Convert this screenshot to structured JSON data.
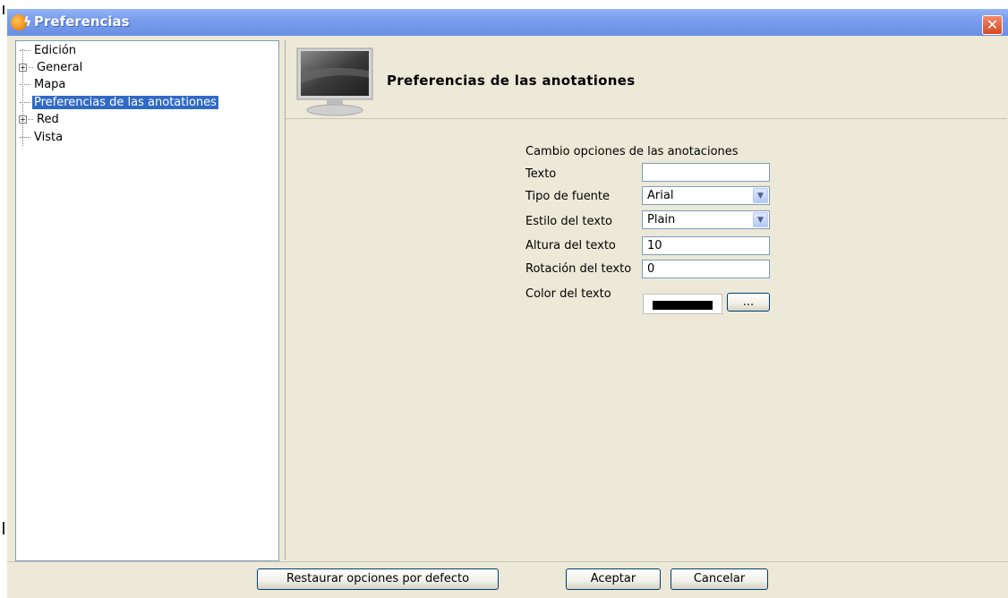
{
  "window": {
    "title": "Preferencias",
    "close_glyph": "✕"
  },
  "tree": {
    "items": [
      {
        "label": "Edición",
        "expandable": false,
        "selected": false
      },
      {
        "label": "General",
        "expandable": true,
        "selected": false
      },
      {
        "label": "Mapa",
        "expandable": false,
        "selected": false
      },
      {
        "label": "Preferencias de las anotationes",
        "expandable": false,
        "selected": true
      },
      {
        "label": "Red",
        "expandable": true,
        "selected": false
      },
      {
        "label": "Vista",
        "expandable": false,
        "selected": false
      }
    ]
  },
  "header": {
    "title": "Preferencias de las anotationes",
    "icon": "monitor-icon"
  },
  "form": {
    "section_title": "Cambio opciones de las anotaciones",
    "texto": {
      "label": "Texto",
      "value": ""
    },
    "tipo_fuente": {
      "label": "Tipo de fuente",
      "value": "Arial"
    },
    "estilo_texto": {
      "label": "Estilo del texto",
      "value": "Plain"
    },
    "altura_texto": {
      "label": "Altura del texto",
      "value": "10"
    },
    "rotacion_texto": {
      "label": "Rotación del texto",
      "value": "0"
    },
    "color_texto": {
      "label": "Color del texto",
      "value": "#000000",
      "button_label": "..."
    }
  },
  "buttons": {
    "restore": "Restaurar opciones por defecto",
    "accept": "Aceptar",
    "cancel": "Cancelar"
  },
  "colors": {
    "titlebar": "#7397e9",
    "selection": "#316ac5",
    "window_bg": "#ece9d8"
  }
}
